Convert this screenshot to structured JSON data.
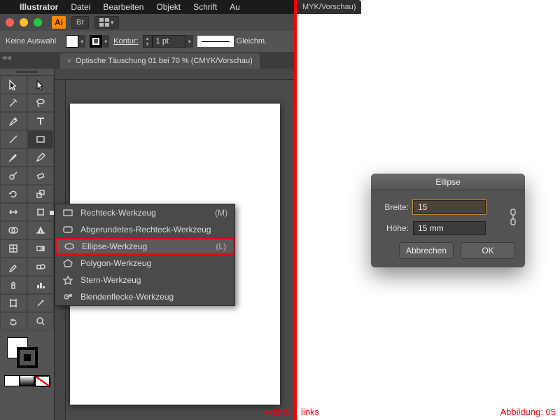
{
  "menubar": {
    "app": "Illustrator",
    "items": [
      "Datei",
      "Bearbeiten",
      "Objekt",
      "Schrift",
      "Au"
    ]
  },
  "window": {
    "ai_badge": "Ai",
    "br_badge": "Br"
  },
  "controlbar": {
    "selection": "Keine Auswahl",
    "stroke_label": "Kontur:",
    "stroke_value": "1 pt",
    "stroke_style": "Gleichm."
  },
  "document": {
    "tab_title": "Optische Täuschung 01 bei 70 % (CMYK/Vorschau)"
  },
  "right_fragment": "MYK/Vorschau)",
  "flyout": {
    "items": [
      {
        "label": "Rechteck-Werkzeug",
        "shortcut": "(M)",
        "icon": "rect"
      },
      {
        "label": "Abgerundetes-Rechteck-Werkzeug",
        "shortcut": "",
        "icon": "roundrect"
      },
      {
        "label": "Ellipse-Werkzeug",
        "shortcut": "(L)",
        "icon": "ellipse",
        "selected": true
      },
      {
        "label": "Polygon-Werkzeug",
        "shortcut": "",
        "icon": "polygon"
      },
      {
        "label": "Stern-Werkzeug",
        "shortcut": "",
        "icon": "star"
      },
      {
        "label": "Blendenflecke-Werkzeug",
        "shortcut": "",
        "icon": "flare"
      }
    ]
  },
  "dialog": {
    "title": "Ellipse",
    "width_label": "Breite:",
    "width_value": "15",
    "height_label": "Höhe:",
    "height_value": "15 mm",
    "cancel": "Abbrechen",
    "ok": "OK"
  },
  "captions": {
    "left": "rechts",
    "right_left": "links",
    "right_right": "Abbildung: 05"
  }
}
